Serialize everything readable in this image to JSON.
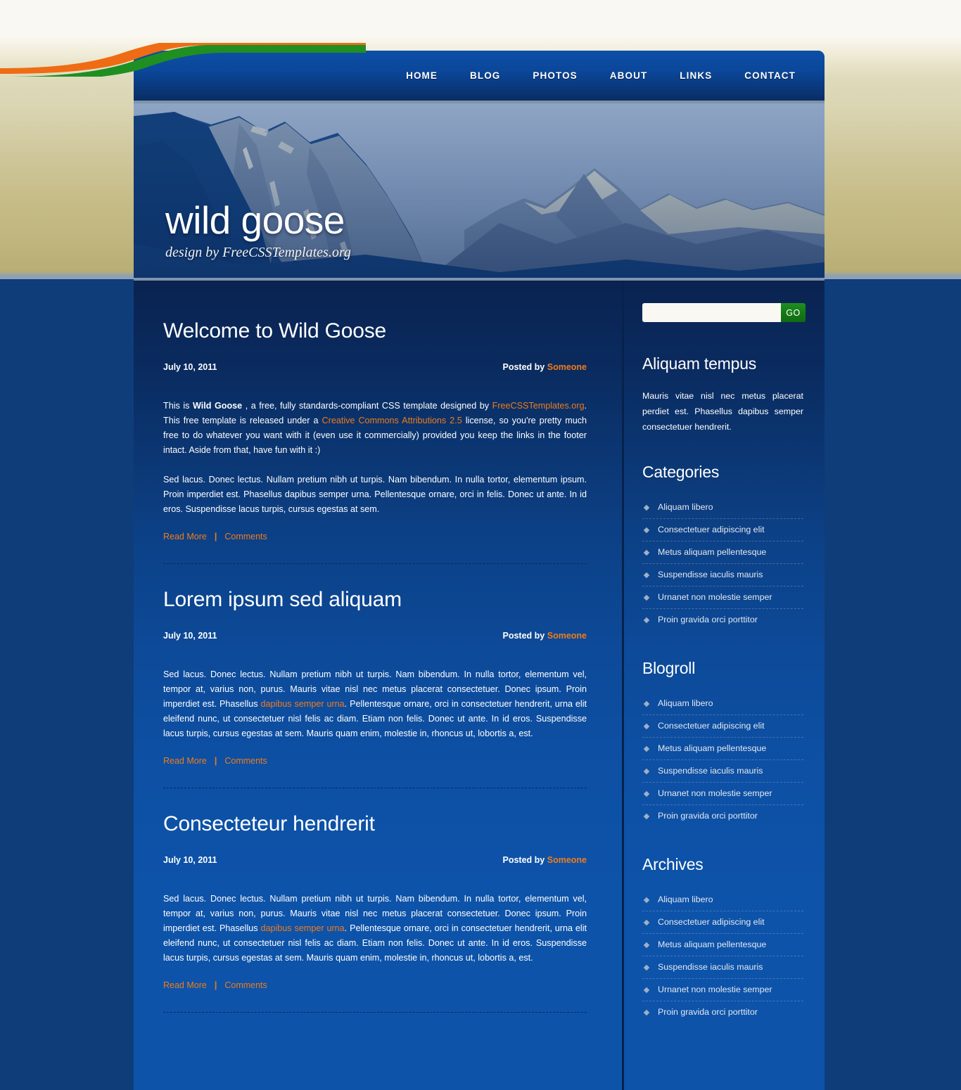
{
  "site": {
    "logo_title": "wild goose",
    "logo_subtitle": "design by FreeCSSTemplates.org",
    "accent_orange": "#ef7c1a",
    "accent_green": "#15821a",
    "brand_blue": "#0d53a9"
  },
  "nav": {
    "items": [
      {
        "label": "HOME"
      },
      {
        "label": "BLOG"
      },
      {
        "label": "PHOTOS"
      },
      {
        "label": "ABOUT"
      },
      {
        "label": "LINKS"
      },
      {
        "label": "CONTACT"
      }
    ]
  },
  "posts": [
    {
      "title": "Welcome to Wild Goose",
      "date": "July 10, 2011",
      "posted_by_label": "Posted by",
      "author": "Someone",
      "para1_a": "This is ",
      "para1_strong": "Wild Goose",
      "para1_b": " , a free, fully standards-compliant CSS template designed by ",
      "para1_link1": "FreeCSSTemplates.org",
      "para1_c": ". This free template is released under a ",
      "para1_link2": "Creative Commons Attributions 2.5",
      "para1_d": " license, so you're pretty much free to do whatever you want with it (even use it commercially) provided you keep the links in the footer intact. Aside from that, have fun with it :)",
      "para2": "Sed lacus. Donec lectus. Nullam pretium nibh ut turpis. Nam bibendum. In nulla tortor, elementum ipsum. Proin imperdiet est. Phasellus dapibus semper urna. Pellentesque ornare, orci in felis. Donec ut ante. In id eros. Suspendisse lacus turpis, cursus egestas at sem.",
      "read_more": "Read More",
      "separator": "|",
      "comments": "Comments"
    },
    {
      "title": "Lorem ipsum sed aliquam",
      "date": "July 10, 2011",
      "posted_by_label": "Posted by",
      "author": "Someone",
      "body_a": "Sed lacus. Donec lectus. Nullam pretium nibh ut turpis. Nam bibendum. In nulla tortor, elementum vel, tempor at, varius non, purus. Mauris vitae nisl nec metus placerat consectetuer. Donec ipsum. Proin imperdiet est. Phasellus ",
      "body_link": "dapibus semper urna",
      "body_b": ". Pellentesque ornare, orci in consectetuer hendrerit, urna elit eleifend nunc, ut consectetuer nisl felis ac diam. Etiam non felis. Donec ut ante. In id eros. Suspendisse lacus turpis, cursus egestas at sem. Mauris quam enim, molestie in, rhoncus ut, lobortis a, est.",
      "read_more": "Read More",
      "separator": "|",
      "comments": "Comments"
    },
    {
      "title": "Consecteteur hendrerit",
      "date": "July 10, 2011",
      "posted_by_label": "Posted by",
      "author": "Someone",
      "body_a": "Sed lacus. Donec lectus. Nullam pretium nibh ut turpis. Nam bibendum. In nulla tortor, elementum vel, tempor at, varius non, purus. Mauris vitae nisl nec metus placerat consectetuer. Donec ipsum. Proin imperdiet est. Phasellus ",
      "body_link": "dapibus semper urna",
      "body_b": ". Pellentesque ornare, orci in consectetuer hendrerit, urna elit eleifend nunc, ut consectetuer nisl felis ac diam. Etiam non felis. Donec ut ante. In id eros. Suspendisse lacus turpis, cursus egestas at sem. Mauris quam enim, molestie in, rhoncus ut, lobortis a, est.",
      "read_more": "Read More",
      "separator": "|",
      "comments": "Comments"
    }
  ],
  "sidebar": {
    "search": {
      "value": "",
      "placeholder": "",
      "button_label": "GO"
    },
    "widgets": [
      {
        "title": "Aliquam tempus",
        "text": "Mauris vitae nisl nec metus placerat perdiet est. Phasellus dapibus semper consectetuer hendrerit."
      },
      {
        "title": "Categories",
        "items": [
          {
            "label": "Aliquam libero"
          },
          {
            "label": "Consectetuer adipiscing elit"
          },
          {
            "label": "Metus aliquam pellentesque"
          },
          {
            "label": "Suspendisse iaculis mauris"
          },
          {
            "label": "Urnanet non molestie semper"
          },
          {
            "label": "Proin gravida orci porttitor"
          }
        ]
      },
      {
        "title": "Blogroll",
        "items": [
          {
            "label": "Aliquam libero"
          },
          {
            "label": "Consectetuer adipiscing elit"
          },
          {
            "label": "Metus aliquam pellentesque"
          },
          {
            "label": "Suspendisse iaculis mauris"
          },
          {
            "label": "Urnanet non molestie semper"
          },
          {
            "label": "Proin gravida orci porttitor"
          }
        ]
      },
      {
        "title": "Archives",
        "items": [
          {
            "label": "Aliquam libero"
          },
          {
            "label": "Consectetuer adipiscing elit"
          },
          {
            "label": "Metus aliquam pellentesque"
          },
          {
            "label": "Suspendisse iaculis mauris"
          },
          {
            "label": "Urnanet non molestie semper"
          },
          {
            "label": "Proin gravida orci porttitor"
          }
        ]
      }
    ]
  }
}
